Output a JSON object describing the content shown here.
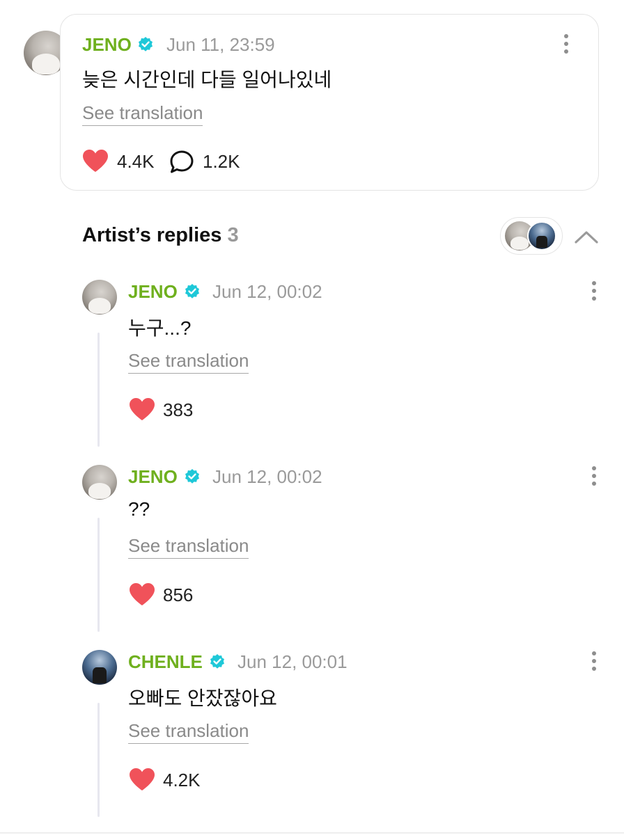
{
  "post": {
    "author": "JENO",
    "time": "Jun 11, 23:59",
    "text": "늦은 시간인데 다들 일어나있네",
    "translate_label": "See translation",
    "likes": "4.4K",
    "comments": "1.2K"
  },
  "replies_section": {
    "title": "Artist’s replies",
    "count": "3"
  },
  "replies": [
    {
      "author": "JENO",
      "time": "Jun 12, 00:02",
      "text": "누구...?",
      "translate_label": "See translation",
      "likes": "383"
    },
    {
      "author": "JENO",
      "time": "Jun 12, 00:02",
      "text": "??",
      "translate_label": "See translation",
      "likes": "856"
    },
    {
      "author": "CHENLE",
      "time": "Jun 12, 00:01",
      "text": "오빠도 안잤잖아요",
      "translate_label": "See translation",
      "likes": "4.2K"
    }
  ],
  "colors": {
    "artist_name": "#6fb01e",
    "verified_badge": "#1ec8d8",
    "heart": "#f0525a",
    "muted_text": "#9a9a9a"
  },
  "icons": [
    "verified-badge-icon",
    "heart-icon",
    "comment-icon",
    "more-vertical-icon",
    "chevron-up-icon"
  ]
}
